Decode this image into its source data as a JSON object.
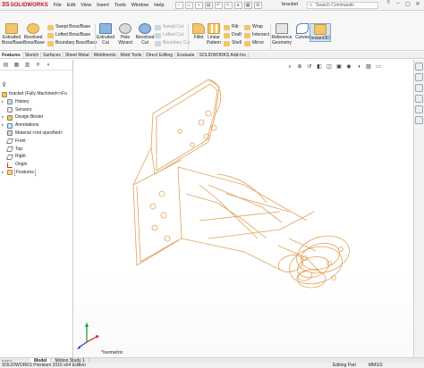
{
  "titlebar": {
    "brand_ds": "3S",
    "brand_name": "SOLIDWORKS",
    "menu": [
      "File",
      "Edit",
      "View",
      "Insert",
      "Tools",
      "Window",
      "Help"
    ],
    "document": "bracket",
    "search_placeholder": "Search Commands",
    "window_controls": [
      "?",
      "–",
      "▢",
      "✕"
    ]
  },
  "ribbon": {
    "extruded_boss": "Extruded Boss/Base",
    "revolved_boss": "Revolved Boss/Base",
    "swept_boss": "Swept Boss/Base",
    "lofted_boss": "Lofted Boss/Base",
    "boundary_boss": "Boundary Boss/Base",
    "extruded_cut": "Extruded Cut",
    "hole_wizard": "Hole Wizard",
    "revolved_cut": "Revolved Cut",
    "swept_cut": "Swept Cut",
    "lofted_cut": "Lofted Cut",
    "boundary_cut": "Boundary Cut",
    "fillet": "Fillet",
    "linear_pattern": "Linear Pattern",
    "rib": "Rib",
    "draft": "Draft",
    "shell": "Shell",
    "wrap": "Wrap",
    "intersect": "Intersect",
    "mirror": "Mirror",
    "reference_geometry": "Reference Geometry",
    "curves": "Curves",
    "instant3d": "Instant3D"
  },
  "tabs": [
    "Features",
    "Sketch",
    "Surfaces",
    "Sheet Metal",
    "Weldments",
    "Mold Tools",
    "Direct Editing",
    "Evaluate",
    "SOLIDWORKS Add-Ins"
  ],
  "tree": {
    "root": "bracket  (Fully Machined<<Fu",
    "items": [
      "History",
      "Sensors",
      "Design Binder",
      "Annotations",
      "Material <not specified>",
      "Front",
      "Top",
      "Right",
      "Origin",
      "Features"
    ]
  },
  "view": {
    "label": "*Isometric"
  },
  "bottom_tabs": [
    "Model",
    "Motion Study 1"
  ],
  "status": {
    "edition": "SOLIDWORKS Premium 2016 x64 Edition",
    "mode": "Editing Part",
    "units": "MMGS"
  },
  "colors": {
    "wireframe": "#e0a25a",
    "brand": "#c8102e",
    "triad_x": "#d02020",
    "triad_y": "#1a9a1a",
    "triad_z": "#2040d0"
  }
}
